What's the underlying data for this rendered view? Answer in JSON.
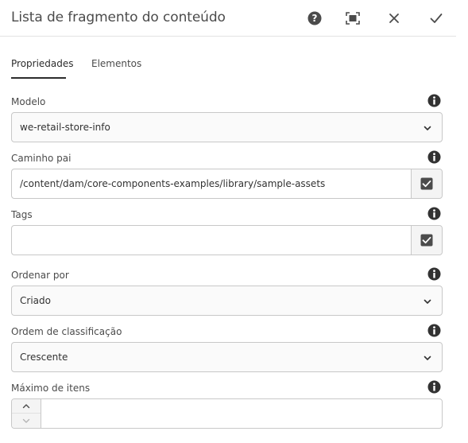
{
  "header": {
    "title": "Lista de fragmento do conteúdo",
    "help_icon": "help-circle-icon",
    "fullscreen_icon": "fullscreen-icon",
    "close_icon": "close-icon",
    "done_icon": "checkmark-icon"
  },
  "tabs": [
    {
      "label": "Propriedades",
      "selected": true
    },
    {
      "label": "Elementos",
      "selected": false
    }
  ],
  "fields": {
    "modelo": {
      "label": "Modelo",
      "value": "we-retail-store-info"
    },
    "caminho": {
      "label": "Caminho pai",
      "value": "/content/dam/core-components-examples/library/sample-assets"
    },
    "tags": {
      "label": "Tags",
      "value": ""
    },
    "ordenar": {
      "label": "Ordenar por",
      "value": "Criado"
    },
    "ordem": {
      "label": "Ordem de classificação",
      "value": "Crescente"
    },
    "maximo": {
      "label": "Máximo de itens",
      "value": ""
    }
  },
  "colors": {
    "accent": "#2c2c2c",
    "border": "#c8c8c8",
    "icon": "#323232"
  }
}
